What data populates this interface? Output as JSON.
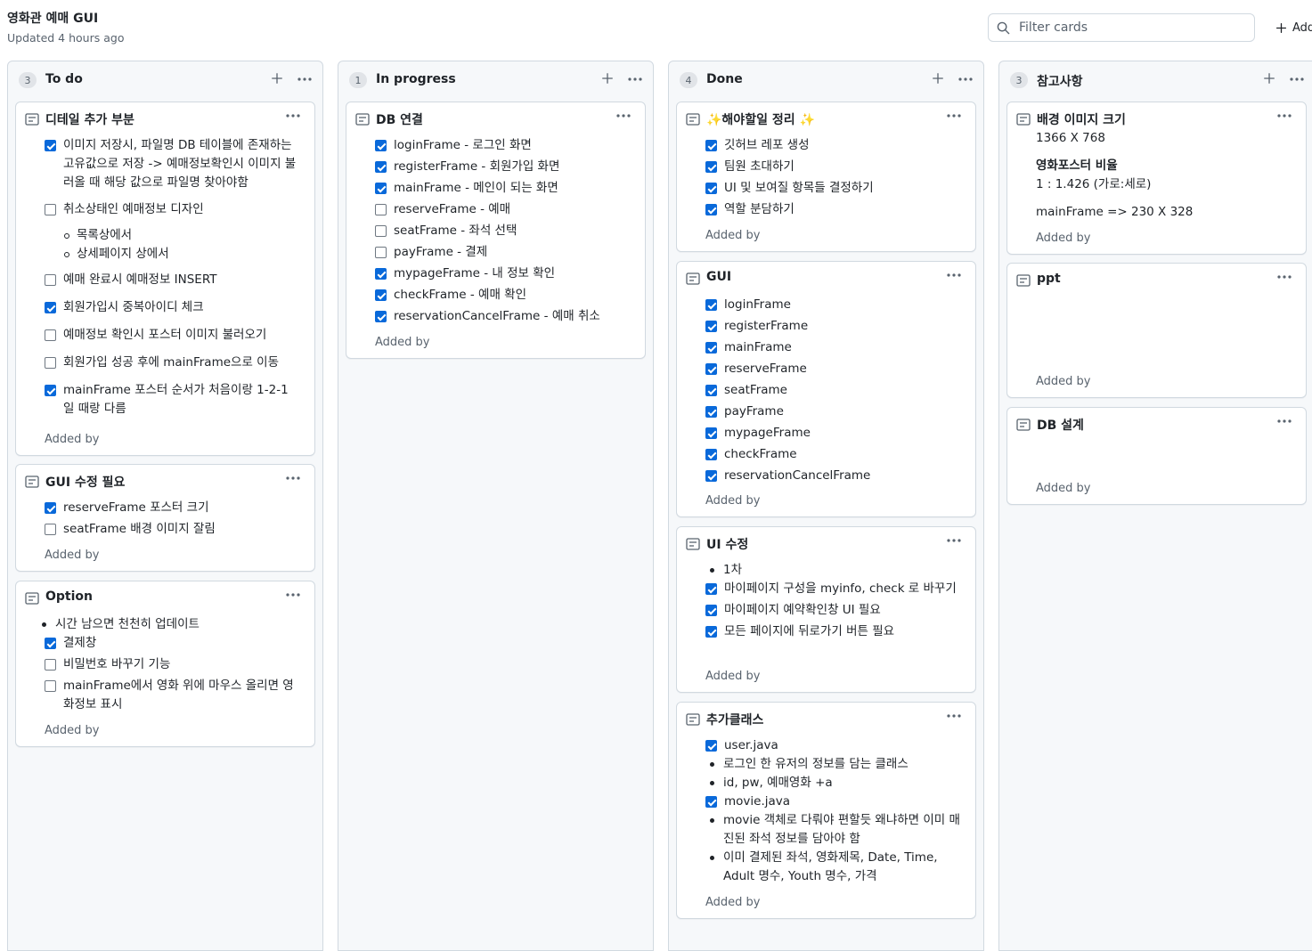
{
  "header": {
    "title": "영화관 예매 GUI",
    "updated": "Updated 4 hours ago",
    "filter_placeholder": "Filter cards",
    "add_label": "Add"
  },
  "columns": [
    {
      "name": "To do",
      "count": "3",
      "cards": [
        {
          "title": "디테일 추가 부분",
          "added": "Added by",
          "items": [
            {
              "text": "이미지 저장시, 파일명 DB 테이블에 존재하는 고유값으로 저장 -> 예매정보확인시 이미지 불러올 때 해당 값으로 파일명 찾아야함",
              "checked": true
            },
            {
              "text": "취소상태인 예매정보 디자인",
              "checked": false
            },
            {
              "text": "목록상에서"
            },
            {
              "text": "상세페이지 상에서"
            },
            {
              "text": "예매 완료시 예매정보 INSERT",
              "checked": false
            },
            {
              "text": "회원가입시 중복아이디 체크",
              "checked": true
            },
            {
              "text": "예매정보 확인시 포스터 이미지 불러오기",
              "checked": false
            },
            {
              "text": "회원가입 성공 후에 mainFrame으로 이동",
              "checked": false
            },
            {
              "text": "mainFrame 포스터 순서가 처음이랑 1-2-1 일 때랑 다름",
              "checked": true
            }
          ]
        },
        {
          "title": "GUI 수정 필요",
          "added": "Added by",
          "items": [
            {
              "text": "reserveFrame 포스터 크기",
              "checked": true
            },
            {
              "text": "seatFrame 배경 이미지 잘림",
              "checked": false
            }
          ]
        },
        {
          "title": "Option",
          "added": "Added by",
          "items": [
            {
              "text": "시간 남으면 천천히 업데이트"
            },
            {
              "text": "결제창",
              "checked": true
            },
            {
              "text": "비밀번호 바꾸기 기능",
              "checked": false
            },
            {
              "text": "mainFrame에서 영화 위에 마우스 올리면 영화정보 표시",
              "checked": false
            }
          ]
        }
      ]
    },
    {
      "name": "In progress",
      "count": "1",
      "cards": [
        {
          "title": "DB 연결",
          "added": "Added by",
          "items": [
            {
              "text": "loginFrame - 로그인 화면",
              "checked": true
            },
            {
              "text": "registerFrame - 회원가입 화면",
              "checked": true
            },
            {
              "text": "mainFrame - 메인이 되는 화면",
              "checked": true
            },
            {
              "text": "reserveFrame - 예매",
              "checked": false
            },
            {
              "text": "seatFrame - 좌석 선택",
              "checked": false
            },
            {
              "text": "payFrame - 결제",
              "checked": false
            },
            {
              "text": "mypageFrame - 내 정보 확인",
              "checked": true
            },
            {
              "text": "checkFrame - 예매 확인",
              "checked": true
            },
            {
              "text": "reservationCancelFrame - 예매 취소",
              "checked": true
            }
          ]
        }
      ]
    },
    {
      "name": "Done",
      "count": "4",
      "cards": [
        {
          "title": "✨해야할일 정리 ✨",
          "added": "Added by",
          "items": [
            {
              "text": "깃허브 레포 생성",
              "checked": true
            },
            {
              "text": "팀원 초대하기",
              "checked": true
            },
            {
              "text": "UI 및 보여질 항목들 결정하기",
              "checked": true
            },
            {
              "text": "역할 분담하기",
              "checked": true
            }
          ]
        },
        {
          "title": "GUI",
          "added": "Added by",
          "items": [
            {
              "text": "loginFrame",
              "checked": true
            },
            {
              "text": "registerFrame",
              "checked": true
            },
            {
              "text": "mainFrame",
              "checked": true
            },
            {
              "text": "reserveFrame",
              "checked": true
            },
            {
              "text": "seatFrame",
              "checked": true
            },
            {
              "text": "payFrame",
              "checked": true
            },
            {
              "text": "mypageFrame",
              "checked": true
            },
            {
              "text": "checkFrame",
              "checked": true
            },
            {
              "text": "reservationCancelFrame",
              "checked": true
            }
          ]
        },
        {
          "title": "UI 수정",
          "added": "Added by",
          "items": [
            {
              "text": "1차"
            },
            {
              "text": "마이페이지 구성을 myinfo, check 로 바꾸기",
              "checked": true
            },
            {
              "text": "마이페이지 예약확인창 UI 필요",
              "checked": true
            },
            {
              "text": "모든 페이지에 뒤로가기 버튼 필요",
              "checked": true
            }
          ]
        },
        {
          "title": "추가클래스",
          "added": "Added by",
          "items": [
            {
              "text": "user.java",
              "checked": true
            },
            {
              "text": "로그인 한 유저의 정보를 담는 클래스"
            },
            {
              "text": "id, pw, 예매영화 +a"
            },
            {
              "text": "movie.java",
              "checked": true
            },
            {
              "text": "movie 객체로 다뤄야 편할듯 왜냐하면 이미 매진된 좌석 정보를 담아야 함"
            },
            {
              "text": "이미 결제된 좌석, 영화제목, Date, Time, Adult 명수, Youth 명수, 가격"
            }
          ]
        }
      ]
    },
    {
      "name": "참고사항",
      "count": "3",
      "cards": [
        {
          "title": "배경 이미지 크기",
          "added": "Added by",
          "lines": [
            "1366 X 768",
            "영화포스터 비율",
            "1 : 1.426 (가로:세로)",
            "mainFrame => 230 X 328"
          ]
        },
        {
          "title": "ppt",
          "added": "Added by",
          "lines": []
        },
        {
          "title": "DB 설계",
          "added": "Added by",
          "lines": []
        }
      ]
    }
  ],
  "icons": {
    "card": "note-icon",
    "column_add": "plus-icon",
    "column_menu": "kebab-horizontal-icon",
    "search": "search-icon"
  },
  "colors": {
    "accent": "#0969da",
    "column_bg": "#f6f8fa",
    "border": "#d1d9e0",
    "muted_text": "#59636e"
  }
}
